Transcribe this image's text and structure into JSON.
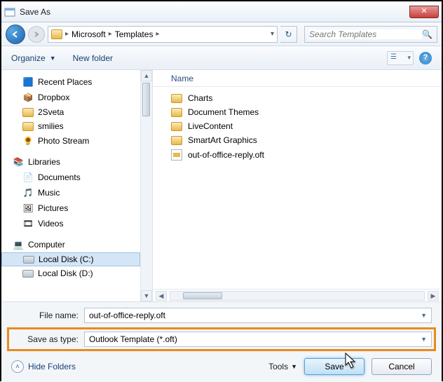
{
  "titlebar": {
    "title": "Save As"
  },
  "nav": {
    "crumbs": [
      "Microsoft",
      "Templates"
    ],
    "search_placeholder": "Search Templates"
  },
  "toolbar": {
    "organize": "Organize",
    "new_folder": "New folder"
  },
  "tree": {
    "recent": "Recent Places",
    "dropbox": "Dropbox",
    "sveta": "2Sveta",
    "smilies": "smilies",
    "photostream": "Photo Stream",
    "libraries": "Libraries",
    "documents": "Documents",
    "music": "Music",
    "pictures": "Pictures",
    "videos": "Videos",
    "computer": "Computer",
    "diskc": "Local Disk (C:)",
    "diskd": "Local Disk (D:)"
  },
  "content": {
    "col_name": "Name",
    "items": [
      "Charts",
      "Document Themes",
      "LiveContent",
      "SmartArt Graphics",
      "out-of-office-reply.oft"
    ]
  },
  "footer": {
    "filename_label": "File name:",
    "filename_value": "out-of-office-reply.oft",
    "savetype_label": "Save as type:",
    "savetype_value": "Outlook Template (*.oft)",
    "hide_folders": "Hide Folders",
    "tools": "Tools",
    "save": "Save",
    "cancel": "Cancel"
  }
}
